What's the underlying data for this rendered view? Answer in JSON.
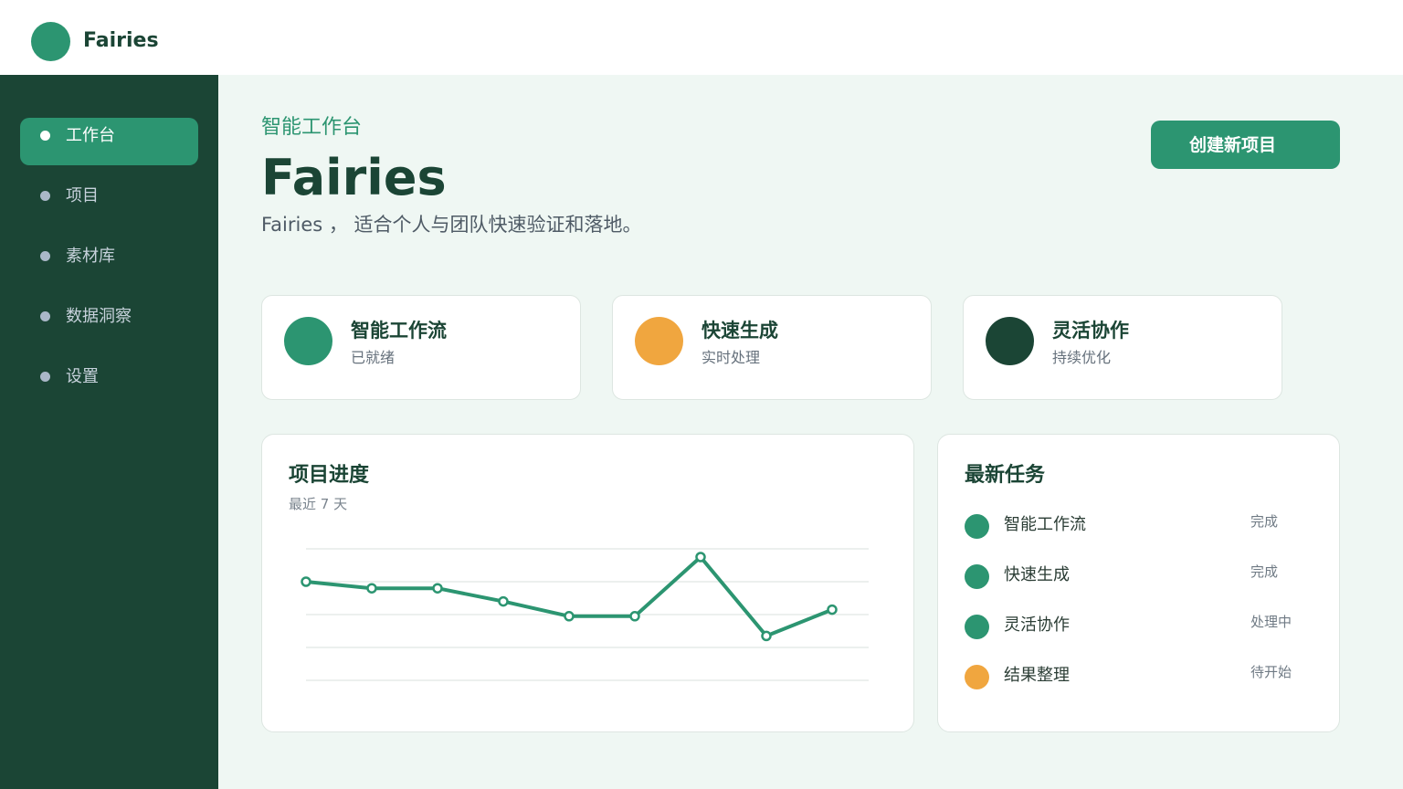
{
  "app": {
    "name": "Fairies"
  },
  "sidebar": {
    "items": [
      {
        "label": "工作台",
        "active": true
      },
      {
        "label": "项目",
        "active": false
      },
      {
        "label": "素材库",
        "active": false
      },
      {
        "label": "数据洞察",
        "active": false
      },
      {
        "label": "设置",
        "active": false
      }
    ]
  },
  "header": {
    "eyebrow": "智能工作台",
    "title": "Fairies",
    "subtitle": "Fairies ，  适合个人与团队快速验证和落地。",
    "create_button": "创建新项目"
  },
  "stats": [
    {
      "title": "智能工作流",
      "sub": "已就绪",
      "color": "#2c9571"
    },
    {
      "title": "快速生成",
      "sub": "实时处理",
      "color": "#f0a63f"
    },
    {
      "title": "灵活协作",
      "sub": "持续优化",
      "color": "#1b4535"
    }
  ],
  "progress": {
    "title": "项目进度",
    "subtitle": "最近 7 天"
  },
  "chart_data": {
    "type": "line",
    "x": [
      1,
      2,
      3,
      4,
      5,
      6,
      7,
      8,
      9
    ],
    "series": [
      {
        "values": [
          70,
          66,
          66,
          58,
          49,
          49,
          85,
          37,
          53
        ],
        "color": "#2c9571"
      }
    ],
    "ylim": [
      10,
      90
    ],
    "grid": true
  },
  "tasks": {
    "title": "最新任务",
    "items": [
      {
        "name": "智能工作流",
        "status": "完成",
        "color": "#2c9571"
      },
      {
        "name": "快速生成",
        "status": "完成",
        "color": "#2c9571"
      },
      {
        "name": "灵活协作",
        "status": "处理中",
        "color": "#2c9571"
      },
      {
        "name": "结果整理",
        "status": "待开始",
        "color": "#f0a63f"
      }
    ]
  }
}
